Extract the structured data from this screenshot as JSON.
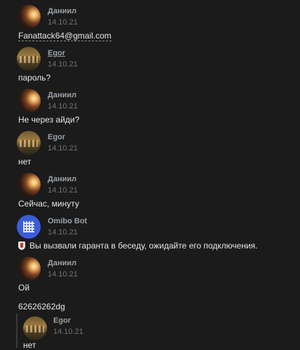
{
  "messages": [
    {
      "author": "Даниил",
      "date": "14.10.21",
      "text": "Fanattack64@gmail.com"
    },
    {
      "author": "Egor",
      "date": "14.10.21",
      "text": "пароль?"
    },
    {
      "author": "Даниил",
      "date": "14.10.21",
      "text": "Не через айди?"
    },
    {
      "author": "Egor",
      "date": "14.10.21",
      "text": "нет"
    },
    {
      "author": "Даниил",
      "date": "14.10.21",
      "text": "Сейчас, минуту"
    },
    {
      "author": "Omibo Bot",
      "date": "14.10.21",
      "text": "Вы вызвали гаранта в беседу, ожидайте его подключения."
    },
    {
      "author": "Даниил",
      "date": "14.10.21",
      "text": "Ой",
      "text2": "62626262dg"
    },
    {
      "author": "Egor",
      "date": "14.10.21",
      "text": "нет"
    }
  ],
  "icons": {
    "bot_message_icon": "shield-icon"
  }
}
